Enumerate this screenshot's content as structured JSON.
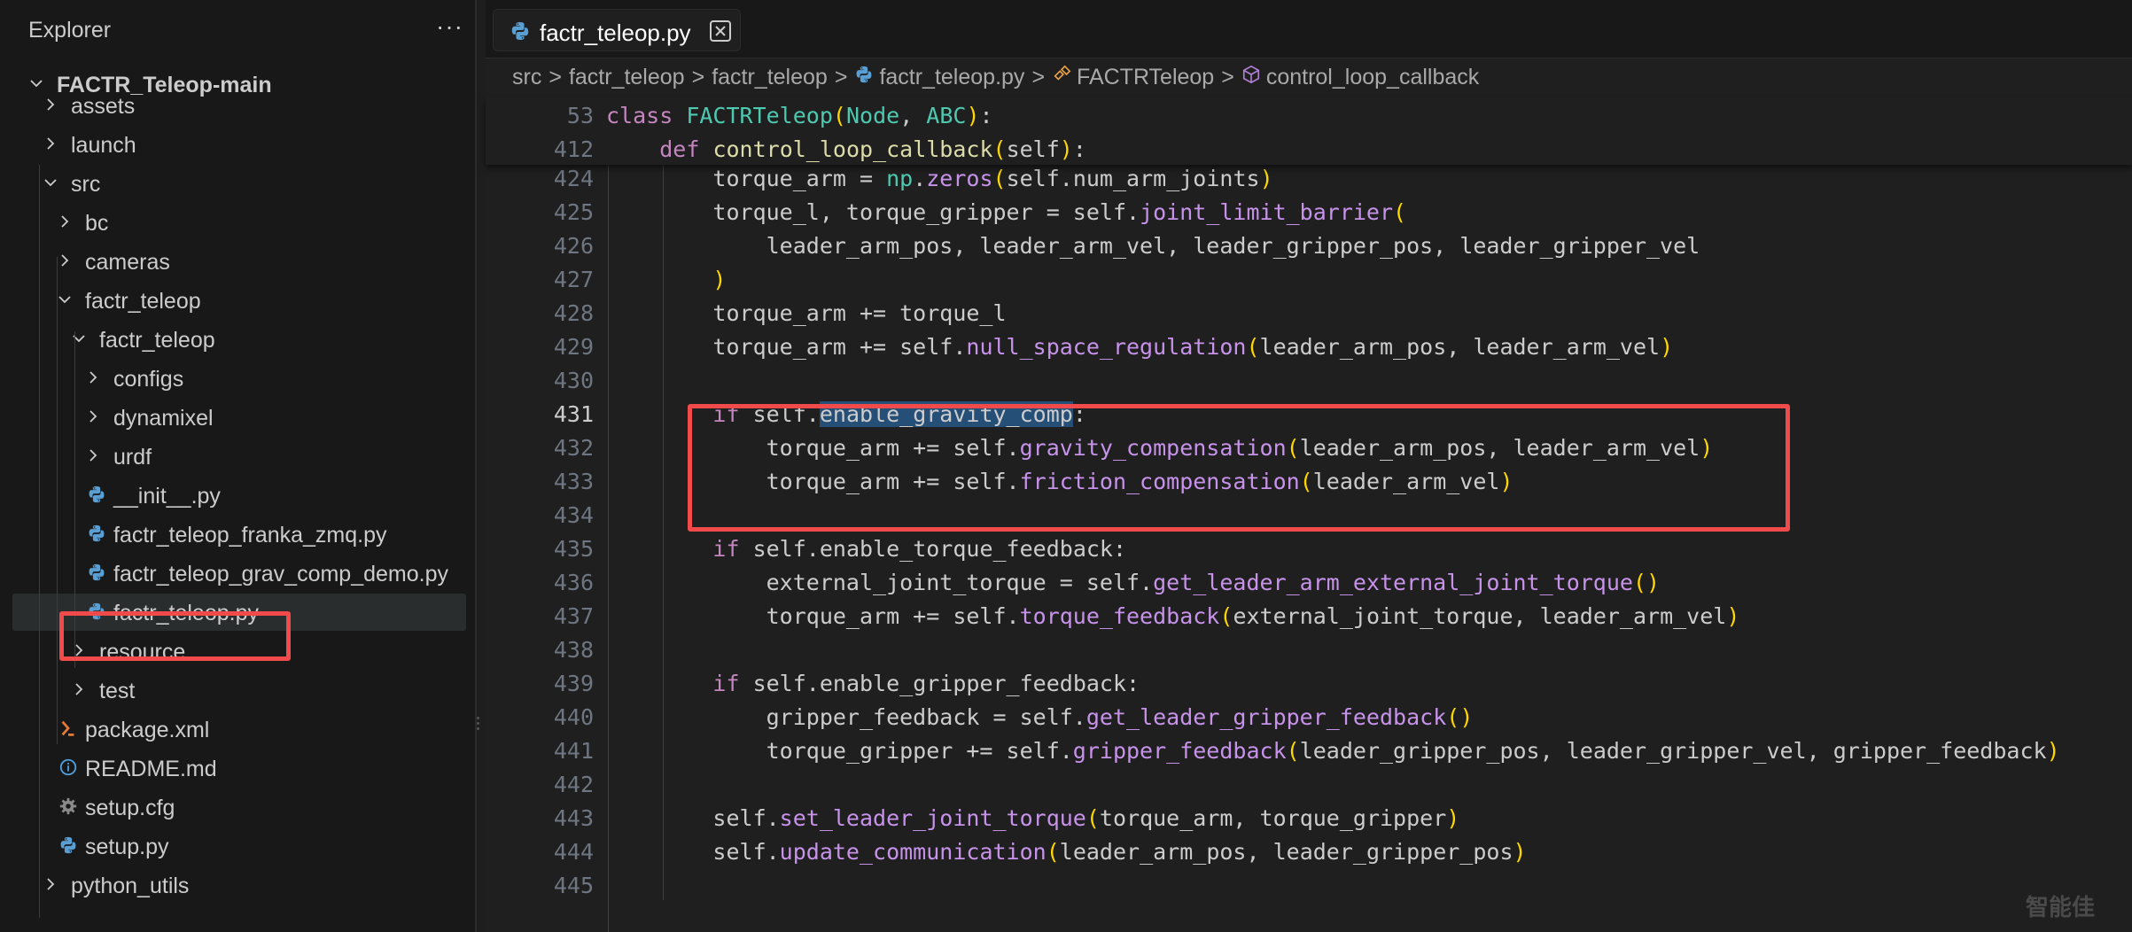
{
  "sidebar": {
    "title": "Explorer",
    "more": "···",
    "tree": [
      {
        "label": "FACTR_Teleop-main",
        "type": "folder",
        "expanded": true
      },
      {
        "label": "assets",
        "type": "folder",
        "expanded": false
      },
      {
        "label": "launch",
        "type": "folder",
        "expanded": false
      },
      {
        "label": "src",
        "type": "folder",
        "expanded": true
      },
      {
        "label": "bc",
        "type": "folder",
        "expanded": false
      },
      {
        "label": "cameras",
        "type": "folder",
        "expanded": false
      },
      {
        "label": "factr_teleop",
        "type": "folder",
        "expanded": true
      },
      {
        "label": "factr_teleop",
        "type": "folder",
        "expanded": true
      },
      {
        "label": "configs",
        "type": "folder",
        "expanded": false
      },
      {
        "label": "dynamixel",
        "type": "folder",
        "expanded": false
      },
      {
        "label": "urdf",
        "type": "folder",
        "expanded": false
      },
      {
        "label": "__init__.py",
        "type": "python"
      },
      {
        "label": "factr_teleop_franka_zmq.py",
        "type": "python"
      },
      {
        "label": "factr_teleop_grav_comp_demo.py",
        "type": "python"
      },
      {
        "label": "factr_teleop.py",
        "type": "python",
        "selected": true
      },
      {
        "label": "resource",
        "type": "folder",
        "expanded": false
      },
      {
        "label": "test",
        "type": "folder",
        "expanded": false
      },
      {
        "label": "package.xml",
        "type": "xml"
      },
      {
        "label": "README.md",
        "type": "info"
      },
      {
        "label": "setup.cfg",
        "type": "gear"
      },
      {
        "label": "setup.py",
        "type": "python"
      },
      {
        "label": "python_utils",
        "type": "folder",
        "expanded": false
      }
    ]
  },
  "editor": {
    "tab": {
      "label": "factr_teleop.py"
    },
    "breadcrumb": {
      "items": [
        "src",
        "factr_teleop",
        "factr_teleop",
        "factr_teleop.py",
        "FACTRTeleop",
        "control_loop_callback"
      ],
      "sep": ">"
    },
    "sticky": [
      {
        "n": "53",
        "code": "class FACTRTeleop(Node, ABC):"
      },
      {
        "n": "412",
        "code": "    def control_loop_callback(self):"
      }
    ],
    "lines": [
      {
        "n": "424",
        "code": "        torque_arm = np.zeros(self.num_arm_joints)"
      },
      {
        "n": "425",
        "code": "        torque_l, torque_gripper = self.joint_limit_barrier("
      },
      {
        "n": "426",
        "code": "            leader_arm_pos, leader_arm_vel, leader_gripper_pos, leader_gripper_vel"
      },
      {
        "n": "427",
        "code": "        )"
      },
      {
        "n": "428",
        "code": "        torque_arm += torque_l"
      },
      {
        "n": "429",
        "code": "        torque_arm += self.null_space_regulation(leader_arm_pos, leader_arm_vel)"
      },
      {
        "n": "430",
        "code": ""
      },
      {
        "n": "431",
        "code": "        if self.enable_gravity_comp:"
      },
      {
        "n": "432",
        "code": "            torque_arm += self.gravity_compensation(leader_arm_pos, leader_arm_vel)"
      },
      {
        "n": "433",
        "code": "            torque_arm += self.friction_compensation(leader_arm_vel)"
      },
      {
        "n": "434",
        "code": ""
      },
      {
        "n": "435",
        "code": "        if self.enable_torque_feedback:"
      },
      {
        "n": "436",
        "code": "            external_joint_torque = self.get_leader_arm_external_joint_torque()"
      },
      {
        "n": "437",
        "code": "            torque_arm += self.torque_feedback(external_joint_torque, leader_arm_vel)"
      },
      {
        "n": "438",
        "code": ""
      },
      {
        "n": "439",
        "code": "        if self.enable_gripper_feedback:"
      },
      {
        "n": "440",
        "code": "            gripper_feedback = self.get_leader_gripper_feedback()"
      },
      {
        "n": "441",
        "code": "            torque_gripper += self.gripper_feedback(leader_gripper_pos, leader_gripper_vel, gripper_feedback)"
      },
      {
        "n": "442",
        "code": ""
      },
      {
        "n": "443",
        "code": "        self.set_leader_joint_torque(torque_arm, torque_gripper)"
      },
      {
        "n": "444",
        "code": "        self.update_communication(leader_arm_pos, leader_gripper_pos)"
      },
      {
        "n": "445",
        "code": ""
      }
    ],
    "active_line": "431",
    "selected_text": "enable_gravity_comp"
  },
  "watermark": "智能佳",
  "colors": {
    "highlight_box": "#f04a4a",
    "keyword": "#c586c0",
    "class_name": "#4ec9b0",
    "function": "#dcdcaa",
    "method": "#c792ea",
    "selection": "#264f78"
  }
}
